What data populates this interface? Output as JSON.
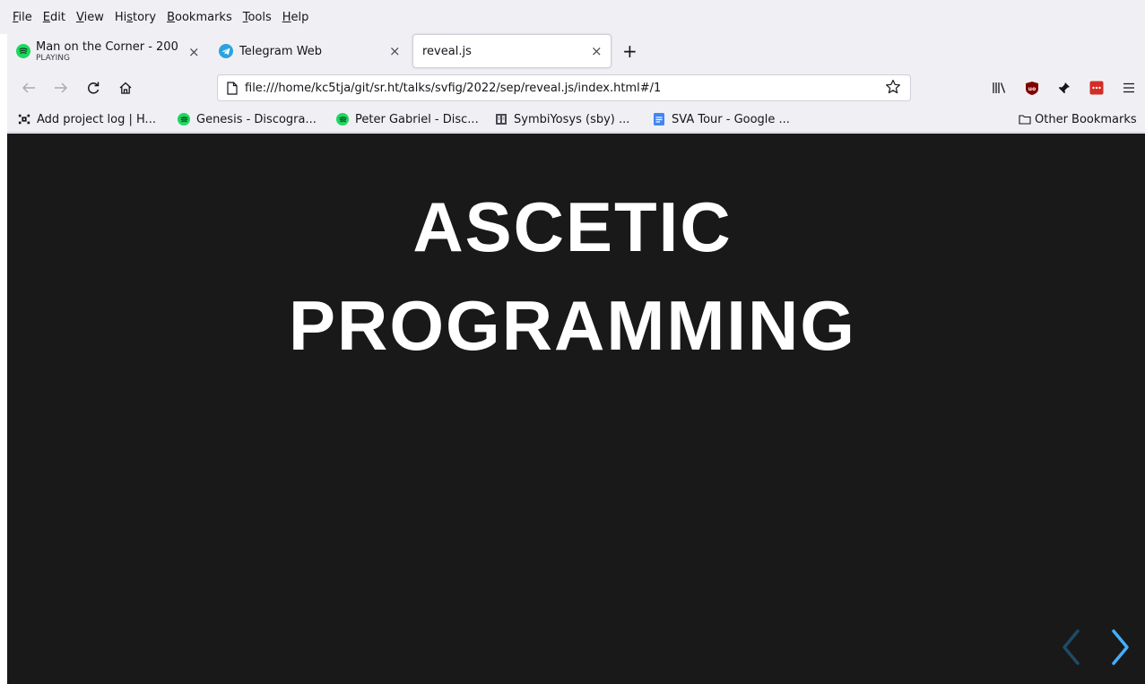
{
  "menubar": {
    "items": [
      {
        "pre": "",
        "key": "F",
        "post": "ile"
      },
      {
        "pre": "",
        "key": "E",
        "post": "dit"
      },
      {
        "pre": "",
        "key": "V",
        "post": "iew"
      },
      {
        "pre": "Hi",
        "key": "s",
        "post": "tory"
      },
      {
        "pre": "",
        "key": "B",
        "post": "ookmarks"
      },
      {
        "pre": "",
        "key": "T",
        "post": "ools"
      },
      {
        "pre": "",
        "key": "H",
        "post": "elp"
      }
    ]
  },
  "tabs": [
    {
      "title": "Man on the Corner - 200",
      "subtitle": "PLAYING",
      "favicon": "spotify-icon"
    },
    {
      "title": "Telegram Web",
      "favicon": "telegram-icon"
    },
    {
      "title": "reveal.js",
      "favicon": "",
      "active": true
    }
  ],
  "tab_close_glyph": "×",
  "new_tab_glyph": "+",
  "navbar": {
    "url": "file:///home/kc5tja/git/sr.ht/talks/svfig/2022/sep/reveal.js/index.html#/1"
  },
  "bookmarks": {
    "items": [
      {
        "label": "Add project log | H...",
        "icon": "hackaday-icon"
      },
      {
        "label": "Genesis - Discogra...",
        "icon": "spotify-icon"
      },
      {
        "label": "Peter Gabriel - Disc...",
        "icon": "spotify-icon"
      },
      {
        "label": "SymbiYosys (sby) ...",
        "icon": "docs-book-icon"
      },
      {
        "label": "SVA Tour - Google ...",
        "icon": "google-docs-icon"
      }
    ],
    "other": "Other Bookmarks"
  },
  "slide": {
    "line1": "ASCETIC",
    "line2": "PROGRAMMING"
  },
  "colors": {
    "slide_bg": "#191919",
    "accent": "#42affa",
    "spotify": "#1ed760",
    "telegram": "#2aa3e0"
  }
}
